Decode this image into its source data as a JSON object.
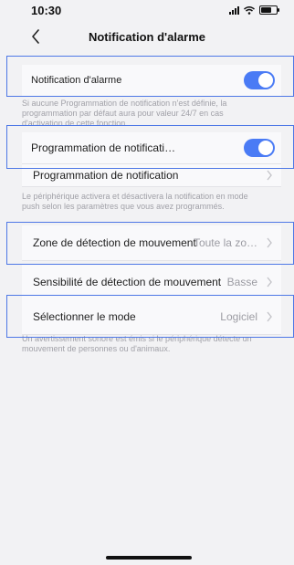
{
  "status_bar": {
    "time": "10:30"
  },
  "nav": {
    "title": "Notification d'alarme"
  },
  "rows": {
    "alarm_notification": {
      "label": "Notification d'alarme",
      "toggle_on": true
    },
    "notification_schedule_toggle": {
      "label": "Programmation de notificati…",
      "toggle_on": true
    },
    "notification_schedule": {
      "label": "Programmation de notification"
    },
    "motion_zone": {
      "label": "Zone de détection de mouvement",
      "value": "Toute la zo…"
    },
    "motion_sensitivity": {
      "label": "Sensibilité de détection de mouvement",
      "value": "Basse"
    },
    "mode": {
      "label": "Sélectionner le mode",
      "value": "Logiciel"
    }
  },
  "notes": {
    "alarm": "Si aucune Programmation de notification n'est définie, la programmation par défaut aura pour valeur 24/7 en cas d'activation de cette fonction.",
    "schedule": "Le périphérique activera et désactivera la notification en mode push selon les paramètres que vous avez programmés.",
    "mode": "Un avertissement sonore est émis si le périphérique détecte un mouvement de personnes ou d'animaux."
  },
  "colors": {
    "accent": "#4a7bf5",
    "highlight": "#4e78e6",
    "background": "#f2f2f4"
  },
  "icons": [
    "signal-icon",
    "wifi-icon",
    "battery-icon",
    "back-chevron-icon",
    "chevron-right-icon"
  ]
}
